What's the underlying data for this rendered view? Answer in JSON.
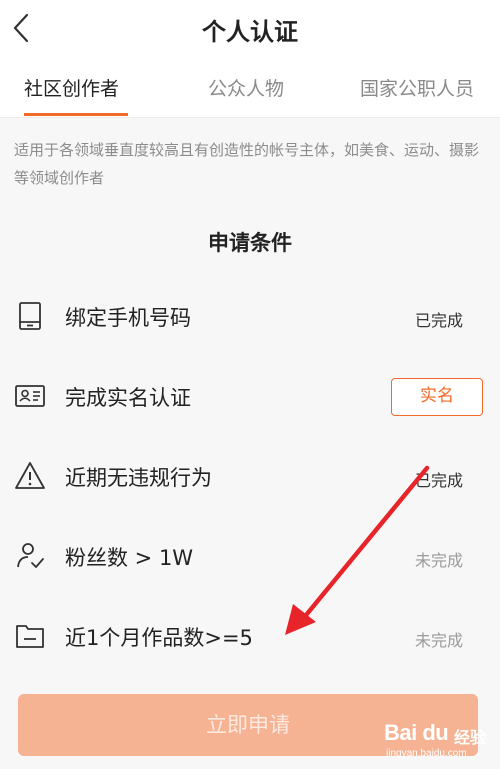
{
  "header": {
    "title": "个人认证"
  },
  "tabs": [
    {
      "label": "社区创作者",
      "active": true
    },
    {
      "label": "公众人物",
      "active": false
    },
    {
      "label": "国家公职人员",
      "active": false
    }
  ],
  "description": "适用于各领域垂直度较高且有创造性的帐号主体，如美食、运动、摄影等领域创作者",
  "section": {
    "title": "申请条件"
  },
  "conditions": [
    {
      "label": "绑定手机号码",
      "status": "已完成",
      "icon": "phone-icon"
    },
    {
      "label": "完成实名认证",
      "action": "实名",
      "icon": "id-card-icon"
    },
    {
      "label": "近期无违规行为",
      "status": "已完成",
      "icon": "warning-icon"
    },
    {
      "label": "粉丝数 > 1W",
      "status": "未完成",
      "icon": "user-check-icon"
    },
    {
      "label": "近1个月作品数>=5",
      "status": "未完成",
      "icon": "folder-icon"
    }
  ],
  "footer": {
    "apply_label": "立即申请"
  },
  "watermark": {
    "logo": "Bai du",
    "sub": "经验",
    "url": "jingyan.baidu.com"
  },
  "colors": {
    "accent": "#f26a2a",
    "apply_button": "#f5b393",
    "annotation_arrow": "#e8242b"
  }
}
